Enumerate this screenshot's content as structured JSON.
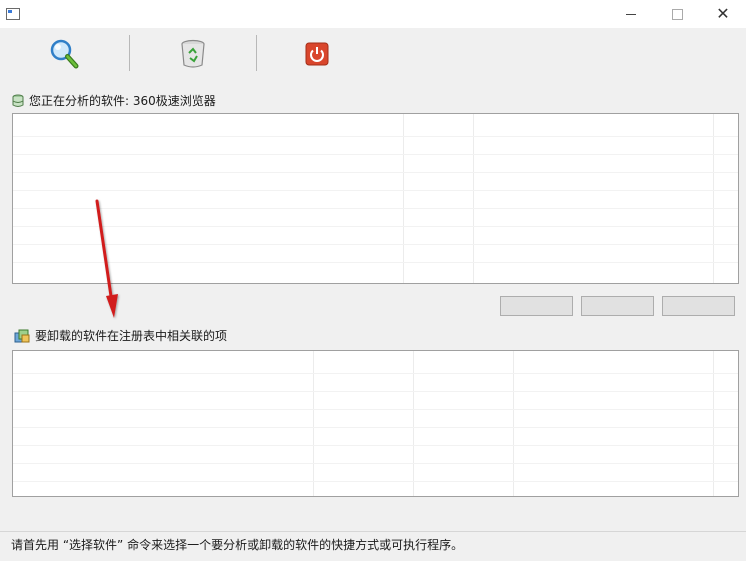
{
  "window": {
    "minimize_glyph": "—",
    "maximize_glyph": "☐",
    "close_glyph": "✕"
  },
  "toolbar": {
    "icons": [
      "search-icon",
      "recycle-bin-icon",
      "power-icon"
    ]
  },
  "analysis_section": {
    "label": "您正在分析的软件: 360极速浏览器",
    "icon": "database-icon",
    "columns": [
      "",
      "",
      ""
    ]
  },
  "buttons": {
    "b1_label": "",
    "b2_label": "",
    "b3_label": ""
  },
  "registry_section": {
    "label": "要卸载的软件在注册表中相关联的项",
    "icon": "registry-icon",
    "columns": [
      "",
      "",
      "",
      ""
    ]
  },
  "status": {
    "text": "请首先用 “选择软件” 命令来选择一个要分析或卸载的软件的快捷方式或可执行程序。"
  },
  "colors": {
    "annotation_arrow": "#d11f1f",
    "power_button": "#d9462c",
    "search_accent": "#2f8de0"
  }
}
